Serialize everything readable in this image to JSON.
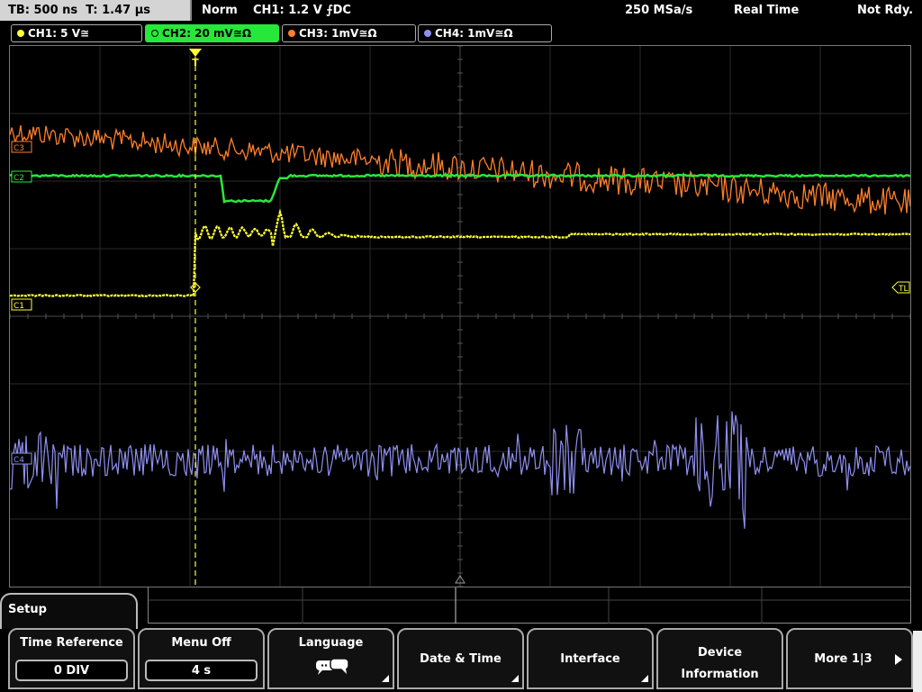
{
  "status_bar": {
    "timebase": "TB: 500 ns",
    "trigger_time": "T: 1.47 µs",
    "trigger_mode": "Norm",
    "trigger_setting": "CH1: 1.2 V ⨍DC",
    "sample_rate": "250 MSa/s",
    "acq_mode": "Real Time",
    "ready_state": "Not Rdy."
  },
  "channels": [
    {
      "label": "CH1: 5 V≅",
      "color": "#ffff33"
    },
    {
      "label": "CH2: 20 mV≅Ω",
      "color": "#27e83a"
    },
    {
      "label": "CH3: 1mV≅Ω",
      "color": "#ff7f2a"
    },
    {
      "label": "CH4: 1mV≅Ω",
      "color": "#8f8ff0"
    }
  ],
  "markers": {
    "ch1": "C1",
    "ch2": "C2",
    "ch3": "C3",
    "ch4": "C4",
    "trigger_level": "TL",
    "trigger_pos": "T"
  },
  "menu": {
    "title": "Setup",
    "softkeys": [
      {
        "label": "Time Reference",
        "value": "0 DIV"
      },
      {
        "label": "Menu Off",
        "value": "4 s"
      },
      {
        "label": "Language",
        "icon": "speech-bubble-icon"
      },
      {
        "label": "Date & Time"
      },
      {
        "label": "Interface"
      },
      {
        "label": "Device",
        "label2": "Information"
      },
      {
        "label": "More 1|3"
      }
    ]
  }
}
